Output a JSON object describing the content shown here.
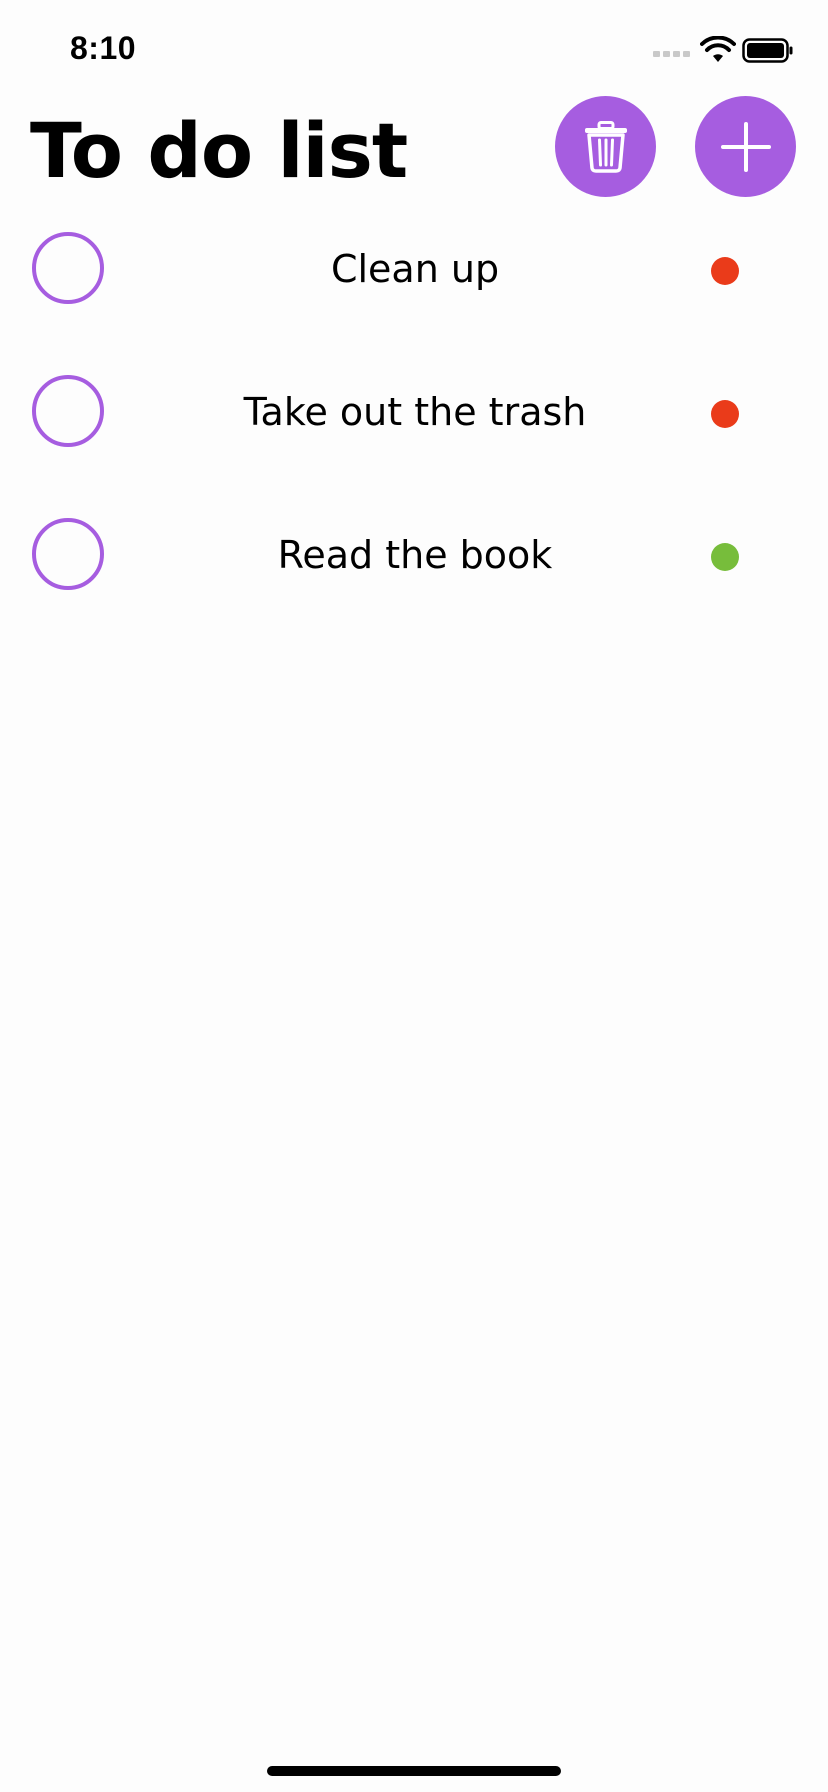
{
  "status_bar": {
    "time": "8:10"
  },
  "header": {
    "title": "To do list",
    "delete_button_icon": "trash-icon",
    "add_button_icon": "plus-icon"
  },
  "todos": [
    {
      "text": "Clean up",
      "completed": false,
      "priority": "high",
      "priority_color": "#ea3b1a"
    },
    {
      "text": "Take out the trash",
      "completed": false,
      "priority": "high",
      "priority_color": "#ea3b1a"
    },
    {
      "text": "Read the book",
      "completed": false,
      "priority": "low",
      "priority_color": "#77bd3b"
    }
  ],
  "colors": {
    "accent": "#a65de0",
    "high_priority": "#ea3b1a",
    "low_priority": "#77bd3b",
    "background": "#fdfdfd"
  }
}
